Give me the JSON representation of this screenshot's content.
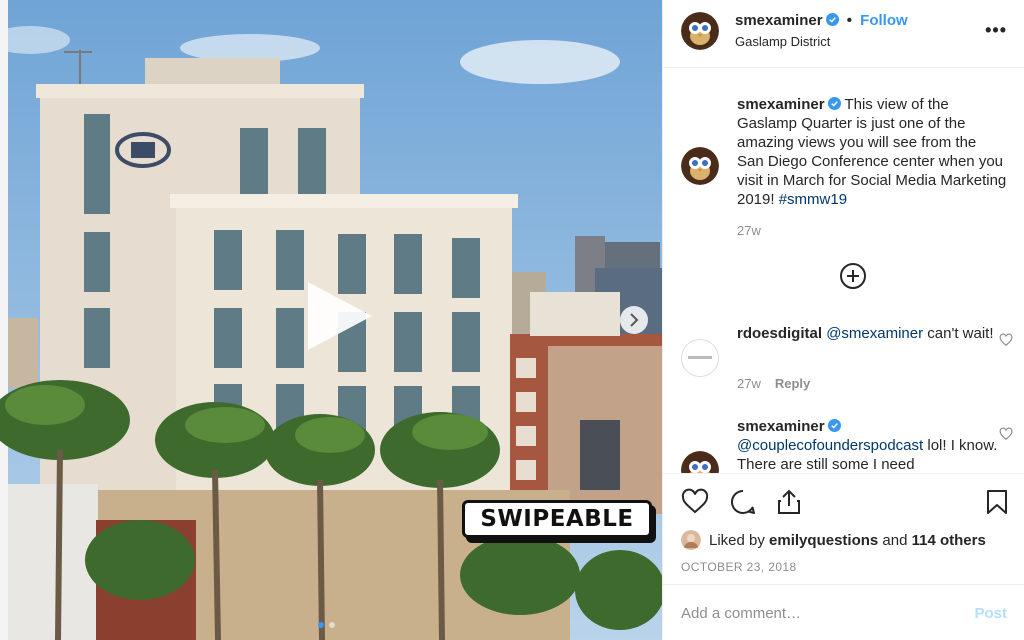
{
  "colors": {
    "accent": "#3897f0",
    "link": "#00376b",
    "muted": "#8e8e8e",
    "post_disabled": "#b2dffc"
  },
  "media": {
    "overlay_label": "SWIPEABLE",
    "play_icon": "play-icon",
    "next_icon": "chevron-right-icon",
    "slide_count": 2,
    "active_slide": 1
  },
  "header": {
    "username": "smexaminer",
    "separator": "•",
    "follow_label": "Follow",
    "location": "Gaslamp District",
    "more_label": "•••"
  },
  "caption": {
    "username": "smexaminer",
    "text": "This view of the Gaslamp Quarter is just one of the amazing views you will see from the San Diego Conference center when you visit in March for Social Media Marketing 2019! ",
    "hashtag": "#smmw19",
    "age": "27w"
  },
  "comments": [
    {
      "username": "rdoesdigital",
      "mention": "@smexaminer",
      "text": " can't wait!",
      "age": "27w",
      "reply_label": "Reply"
    },
    {
      "username": "smexaminer",
      "mention": "@couplecofounderspodcast",
      "text": " lol! I know. There are still some I need"
    }
  ],
  "actions": {
    "liked_by_prefix": "Liked by",
    "liked_by_user": "emilyquestions",
    "liked_by_and": "and",
    "others": "114 others",
    "date": "OCTOBER 23, 2018"
  },
  "composer": {
    "placeholder": "Add a comment…",
    "post_label": "Post"
  }
}
